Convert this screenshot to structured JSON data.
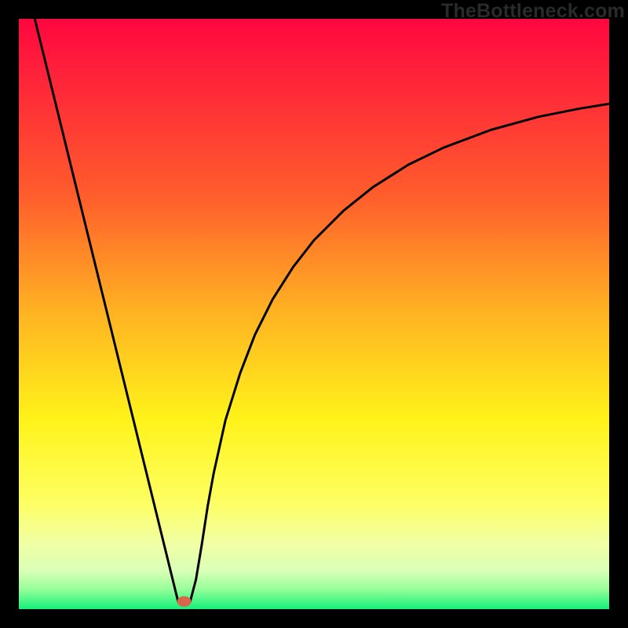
{
  "watermark": {
    "text": "TheBottleneck.com"
  },
  "chart_data": {
    "type": "line",
    "title": "",
    "xlabel": "",
    "ylabel": "",
    "xlim": [
      0,
      100
    ],
    "ylim": [
      0,
      100
    ],
    "grid": false,
    "background_gradient": {
      "stops": [
        {
          "offset": 0.0,
          "color": "#ff0740"
        },
        {
          "offset": 0.3,
          "color": "#ff5d2c"
        },
        {
          "offset": 0.5,
          "color": "#ffb422"
        },
        {
          "offset": 0.68,
          "color": "#fff31a"
        },
        {
          "offset": 0.82,
          "color": "#fdff63"
        },
        {
          "offset": 0.89,
          "color": "#f1ffa6"
        },
        {
          "offset": 0.935,
          "color": "#d9ffb6"
        },
        {
          "offset": 0.965,
          "color": "#9aff9a"
        },
        {
          "offset": 1.0,
          "color": "#14f07a"
        }
      ]
    },
    "series": [
      {
        "name": "left-branch",
        "x": [
          2.7,
          27.0
        ],
        "y": [
          100.0,
          1.2
        ],
        "stroke": "#000000",
        "width": 3
      },
      {
        "name": "right-branch",
        "x": [
          29.0,
          30.0,
          31.0,
          32.0,
          33.0,
          35.0,
          37.5,
          40.0,
          43.0,
          46.5,
          50.0,
          55.0,
          60.0,
          66.0,
          72.0,
          80.0,
          88.0,
          95.0,
          100.0
        ],
        "y": [
          1.2,
          5.0,
          11.0,
          17.5,
          23.0,
          32.0,
          40.0,
          46.5,
          52.5,
          58.0,
          62.5,
          67.5,
          71.5,
          75.3,
          78.2,
          81.2,
          83.4,
          84.8,
          85.6
        ],
        "stroke": "#000000",
        "width": 3
      }
    ],
    "marker": {
      "name": "minimum-point",
      "x": 28.0,
      "y": 1.3,
      "rx": 1.2,
      "ry": 0.9,
      "color": "#d9664b"
    }
  }
}
